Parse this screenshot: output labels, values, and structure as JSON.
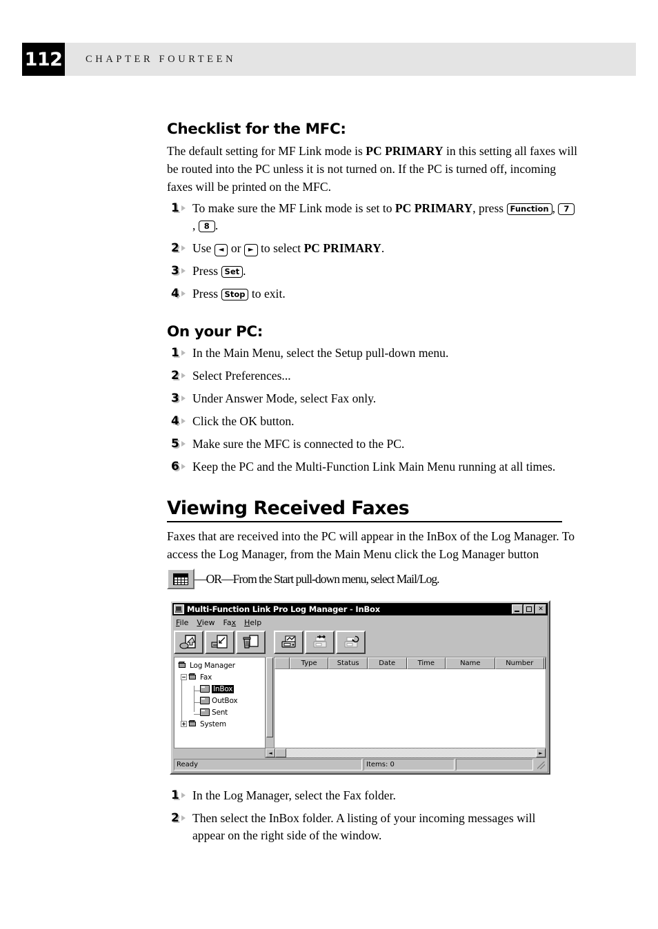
{
  "header": {
    "page_number": "112",
    "chapter_label": "CHAPTER FOURTEEN"
  },
  "sections": {
    "checklist": {
      "heading": "Checklist for the MFC:",
      "paragraph_part1": "The default setting for MF Link mode is ",
      "paragraph_bold": "PC PRIMARY",
      "paragraph_part2": " in this setting all faxes will be routed into the PC unless it is not turned on. If the PC is turned off, incoming faxes will be printed on the MFC.",
      "steps": [
        {
          "num": "1",
          "text_a": "To make sure the MF Link mode is set to ",
          "bold_a": "PC PRIMARY",
          "text_b": ", press ",
          "key1": "Function",
          "sep1": ", ",
          "key2": "7",
          "sep2": " , ",
          "key3": "8",
          "text_c": "."
        },
        {
          "num": "2",
          "text_a": "Use ",
          "key1": "◄",
          "text_b": " or ",
          "key2": "►",
          "text_c": " to select ",
          "bold_a": "PC PRIMARY",
          "text_d": "."
        },
        {
          "num": "3",
          "text_a": "Press ",
          "key1": "Set",
          "text_b": "."
        },
        {
          "num": "4",
          "text_a": "Press ",
          "key1": "Stop",
          "text_b": " to exit."
        }
      ]
    },
    "on_your_pc": {
      "heading": "On your PC:",
      "steps": [
        {
          "num": "1",
          "text": "In the Main Menu, select the Setup pull-down menu."
        },
        {
          "num": "2",
          "text": "Select Preferences..."
        },
        {
          "num": "3",
          "text": "Under Answer Mode, select Fax only."
        },
        {
          "num": "4",
          "text": "Click the OK button."
        },
        {
          "num": "5",
          "text": "Make sure the MFC is connected to the PC."
        },
        {
          "num": "6",
          "text": "Keep the PC and the Multi-Function Link Main Menu running at all times."
        }
      ]
    },
    "viewing": {
      "heading": "Viewing Received Faxes",
      "paragraph": "Faxes that are received into the PC will appear in the InBox of the Log Manager. To access the Log Manager, from the Main Menu click the Log Manager button",
      "or_text": "—OR—From the Start pull-down menu, select  Mail/Log.",
      "steps": [
        {
          "num": "1",
          "text": "In the Log Manager, select the Fax folder."
        },
        {
          "num": "2",
          "text": "Then select the InBox folder.  A listing of your incoming messages will appear on the right side of the window."
        }
      ]
    }
  },
  "screenshot": {
    "title_main": "Multi-Function Link Pro Log Manager",
    "title_sep": " - ",
    "title_doc": "InBox",
    "window_controls": {
      "minimize": "",
      "maximize": "",
      "close": "✕"
    },
    "menus": [
      {
        "pre": "",
        "hot": "F",
        "post": "ile"
      },
      {
        "pre": "",
        "hot": "V",
        "post": "iew"
      },
      {
        "pre": "Fa",
        "hot": "x",
        "post": ""
      },
      {
        "pre": "",
        "hot": "H",
        "post": "elp"
      }
    ],
    "toolbar_buttons": [
      {
        "name": "open-fax-button"
      },
      {
        "name": "move-fax-button"
      },
      {
        "name": "delete-fax-button"
      },
      {
        "name": "send-fax-button"
      },
      {
        "name": "forward-fax-button"
      },
      {
        "name": "resend-fax-button"
      }
    ],
    "tree": [
      {
        "label": "Log Manager",
        "level": 0,
        "icon": "system",
        "expander": "none",
        "selected": false
      },
      {
        "label": "Fax",
        "level": 1,
        "icon": "system",
        "expander": "minus",
        "selected": false
      },
      {
        "label": "InBox",
        "level": 2,
        "icon": "folder",
        "expander": "none",
        "selected": true
      },
      {
        "label": "OutBox",
        "level": 2,
        "icon": "folder",
        "expander": "none",
        "selected": false
      },
      {
        "label": "Sent",
        "level": 2,
        "icon": "folder",
        "expander": "none",
        "selected": false
      },
      {
        "label": "System",
        "level": 1,
        "icon": "system",
        "expander": "plus",
        "selected": false
      }
    ],
    "columns": [
      "Type",
      "Status",
      "Date",
      "Time",
      "Name",
      "Number"
    ],
    "rows": [],
    "scroll": {
      "left_arrow": "◄",
      "right_arrow": "►"
    },
    "statusbar": {
      "message": "Ready",
      "items": "Items: 0",
      "extra": ""
    }
  }
}
